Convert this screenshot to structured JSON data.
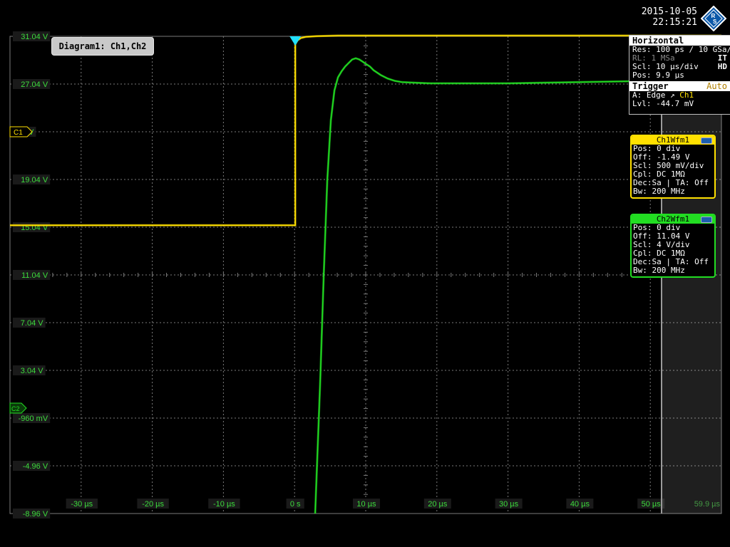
{
  "header": {
    "date": "2015-10-05",
    "time": "22:15:21",
    "logo_text": "R&S"
  },
  "diagram_tab": {
    "label": "Diagram1: Ch1,Ch2"
  },
  "horizontal": {
    "title": "Horizontal",
    "res": "Res: 100 ps / 10 GSa/s",
    "rl_label": "RL:  1 MSa",
    "rl_flag": "IT",
    "scl": "Scl:  10 µs/div",
    "scl_flag": "HD",
    "pos": "Pos:  9.9 µs"
  },
  "trigger": {
    "title": "Trigger",
    "mode": "Auto",
    "source_prefix": "A:    Edge",
    "source_channel": "Ch1",
    "level": "Lvl:   -44.7 mV"
  },
  "ch1_info": {
    "title": "Ch1Wfm1",
    "rows": [
      "Pos: 0 div",
      "Off:  -1.49 V",
      "Scl:  500 mV/div",
      "Cpl:  DC 1MΩ",
      "Dec:Sa | TA: Off",
      "Bw: 200 MHz"
    ]
  },
  "ch2_info": {
    "title": "Ch2Wfm1",
    "rows": [
      "Pos: 0 div",
      "Off:  11.04 V",
      "Scl:  4 V/div",
      "Cpl:  DC 1MΩ",
      "Dec:Sa | TA: Off",
      "Bw: 200 MHz"
    ]
  },
  "markers": {
    "c1": "C1",
    "c2": "C2",
    "trigger_t": "T"
  },
  "colors": {
    "ch1": "#ffe000",
    "ch2": "#22dd22",
    "grid": "#7a7a7a",
    "trigger": "#20e0ff"
  },
  "chart_data": {
    "type": "line",
    "x_unit": "µs",
    "x_ticks": [
      -30,
      -20,
      -10,
      0,
      10,
      20,
      30,
      40,
      50
    ],
    "x_tick_labels": [
      "-30 µs",
      "-20 µs",
      "-10 µs",
      "0 s",
      "10 µs",
      "20 µs",
      "30 µs",
      "40 µs",
      "50 µs"
    ],
    "x_end_label": "59.9 µs",
    "xlim": [
      -40.1,
      59.9
    ],
    "y_unit": "V",
    "y_ticks": [
      31.04,
      27.04,
      23.04,
      19.04,
      15.04,
      11.04,
      7.04,
      3.04,
      -0.96,
      -4.96,
      -8.96
    ],
    "y_tick_labels": [
      "31.04 V",
      "27.04 V",
      "04 V",
      "19.04 V",
      "15.04 V",
      "11.04 V",
      "7.04 V",
      "3.04 V",
      "-960 mV",
      "-4.96 V",
      "-8.96 V"
    ],
    "ylim": [
      -8.96,
      31.04
    ],
    "grid": true,
    "series": [
      {
        "name": "Ch1",
        "color": "#ffe000",
        "x": [
          -40.1,
          0.0,
          0.0,
          0.3,
          0.8,
          1.5,
          3,
          6,
          10,
          20,
          40,
          59.9
        ],
        "y": [
          15.2,
          15.2,
          30.4,
          30.7,
          30.9,
          31.0,
          31.05,
          31.1,
          31.1,
          31.1,
          31.1,
          31.1
        ]
      },
      {
        "name": "Ch2",
        "color": "#22dd22",
        "x": [
          2.8,
          3.5,
          4.0,
          4.5,
          5.0,
          5.5,
          6.0,
          6.5,
          7.0,
          7.5,
          8.0,
          8.5,
          9.0,
          9.5,
          10.0,
          10.5,
          11.0,
          12.0,
          13.0,
          14.0,
          15.0,
          17.0,
          19.0,
          22.0,
          30.0,
          40.0,
          50.0,
          59.9
        ],
        "y": [
          -8.96,
          2.0,
          11.0,
          19.0,
          24.0,
          26.5,
          27.6,
          28.1,
          28.5,
          28.8,
          29.1,
          29.2,
          29.1,
          28.9,
          28.7,
          28.5,
          28.2,
          27.8,
          27.5,
          27.3,
          27.2,
          27.15,
          27.1,
          27.1,
          27.1,
          27.2,
          27.3,
          27.4
        ]
      }
    ]
  }
}
